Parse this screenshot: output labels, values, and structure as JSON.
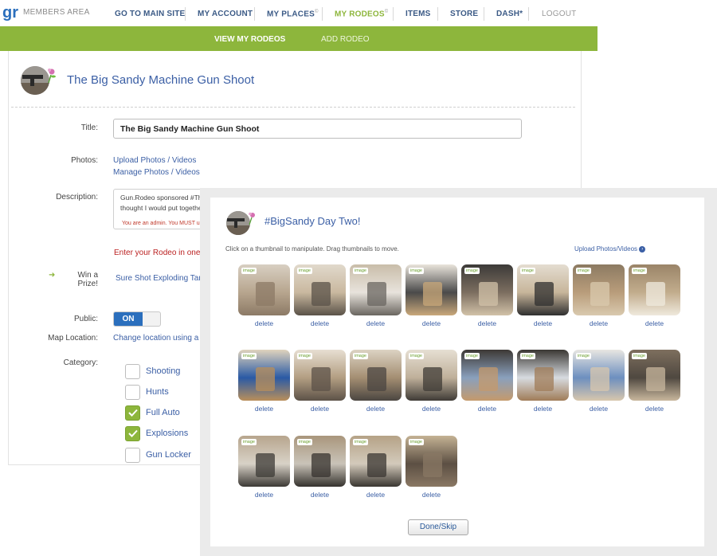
{
  "header": {
    "logo_text": "gr",
    "members_label": "MEMBERS AREA",
    "nav": [
      {
        "label": "GO TO MAIN SITE"
      },
      {
        "label": "MY ACCOUNT"
      },
      {
        "label": "MY PLACES"
      },
      {
        "label": "MY RODEOS"
      },
      {
        "label": "ITEMS"
      },
      {
        "label": "STORE"
      },
      {
        "label": "DASH*"
      },
      {
        "label": "LOGOUT"
      }
    ],
    "places_mark": "©",
    "rodeos_mark": "©",
    "subnav": [
      {
        "label": "VIEW MY RODEOS"
      },
      {
        "label": "ADD RODEO"
      }
    ]
  },
  "rodeo": {
    "title": "The Big Sandy Machine Gun Shoot"
  },
  "form": {
    "title_label": "Title:",
    "title_value": "The Big Sandy Machine Gun Shoot",
    "photos_label": "Photos:",
    "upload_link": "Upload Photos / Videos",
    "manage_link": "Manage Photos / Videos",
    "description_label": "Description:",
    "description_line1": "Gun.Rodeo sponsored #The",
    "description_line2": "thought I would put togethe",
    "admin_note": "You are an admin. You MUST us",
    "enter_note": "Enter your Rodeo in one o",
    "prize_label": "Win a Prize!",
    "prize_link": "Sure Shot Exploding Tar",
    "public_label": "Public:",
    "toggle_on": "ON",
    "map_label": "Map Location:",
    "map_link": "Change location using a",
    "category_label": "Category:",
    "categories": [
      {
        "label": "Shooting",
        "checked": false
      },
      {
        "label": "Hunts",
        "checked": false
      },
      {
        "label": "Full Auto",
        "checked": true
      },
      {
        "label": "Explosions",
        "checked": true
      },
      {
        "label": "Gun Locker",
        "checked": false
      }
    ]
  },
  "modal": {
    "title": "#BigSandy Day Two!",
    "instructions": "Click on a thumbnail to manipulate. Drag thumbnails to move.",
    "upload_link": "Upload Photos/Videos",
    "tag": "image",
    "delete_label": "delete",
    "done_button": "Done/Skip",
    "thumbnail_count": 20
  },
  "colors": {
    "accent_green": "#8db63c",
    "link_blue": "#3b5fa5",
    "toggle_blue": "#2b6fbd"
  }
}
